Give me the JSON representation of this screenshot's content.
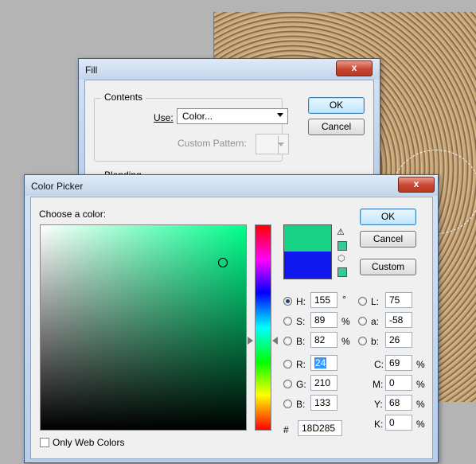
{
  "fill_dialog": {
    "title": "Fill",
    "close_label": "x",
    "contents_group": "Contents",
    "use_label": "Use:",
    "use_value": "Color...",
    "custom_pattern_label": "Custom Pattern:",
    "blending_group": "Blending",
    "ok_label": "OK",
    "cancel_label": "Cancel"
  },
  "color_picker": {
    "title": "Color Picker",
    "close_label": "x",
    "choose_label": "Choose a color:",
    "ok_label": "OK",
    "cancel_label": "Cancel",
    "custom_label": "Custom",
    "new_color": "#18d285",
    "current_color": "#0f18ef",
    "web_safe_color": "#33cc99",
    "hue_color": "#00ff8c",
    "fields": {
      "H": {
        "label": "H:",
        "value": "155",
        "unit": "°",
        "selected": true
      },
      "S": {
        "label": "S:",
        "value": "89",
        "unit": "%"
      },
      "B": {
        "label": "B:",
        "value": "82",
        "unit": "%"
      },
      "R": {
        "label": "R:",
        "value": "24"
      },
      "G": {
        "label": "G:",
        "value": "210"
      },
      "Bl": {
        "label": "B:",
        "value": "133"
      },
      "L": {
        "label": "L:",
        "value": "75"
      },
      "a": {
        "label": "a:",
        "value": "-58"
      },
      "b": {
        "label": "b:",
        "value": "26"
      },
      "C": {
        "label": "C:",
        "value": "69",
        "unit": "%"
      },
      "M": {
        "label": "M:",
        "value": "0",
        "unit": "%"
      },
      "Y": {
        "label": "Y:",
        "value": "68",
        "unit": "%"
      },
      "K": {
        "label": "K:",
        "value": "0",
        "unit": "%"
      }
    },
    "hex_label": "#",
    "hex_value": "18D285",
    "only_web_colors_label": "Only Web Colors"
  }
}
